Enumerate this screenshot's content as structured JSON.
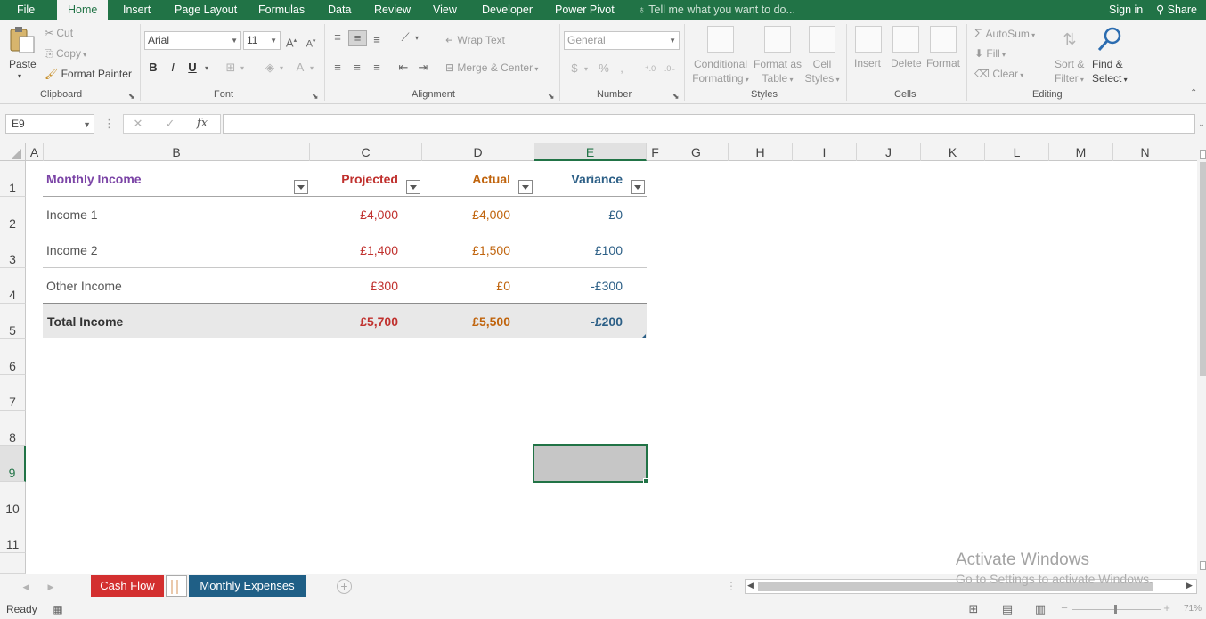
{
  "ribbon_tabs": {
    "file": "File",
    "home": "Home",
    "insert": "Insert",
    "page_layout": "Page Layout",
    "formulas": "Formulas",
    "data": "Data",
    "review": "Review",
    "view": "View",
    "developer": "Developer",
    "power_pivot": "Power Pivot",
    "tell_me": "Tell me what you want to do...",
    "sign_in": "Sign in",
    "share": "Share"
  },
  "clipboard": {
    "paste": "Paste",
    "cut": "Cut",
    "copy": "Copy",
    "format_painter": "Format Painter",
    "label": "Clipboard"
  },
  "font": {
    "name": "Arial",
    "size": "11",
    "bold": "B",
    "italic": "I",
    "underline": "U",
    "label": "Font"
  },
  "alignment": {
    "wrap_text": "Wrap Text",
    "merge_center": "Merge & Center",
    "label": "Alignment"
  },
  "number": {
    "format": "General",
    "currency": "$",
    "percent": "%",
    "comma": ",",
    "label": "Number"
  },
  "styles": {
    "conditional_formatting": [
      "Conditional",
      "Formatting"
    ],
    "format_as_table": [
      "Format as",
      "Table"
    ],
    "cell_styles": [
      "Cell",
      "Styles"
    ],
    "label": "Styles"
  },
  "cells": {
    "insert": "Insert",
    "delete": "Delete",
    "format": "Format",
    "label": "Cells"
  },
  "editing": {
    "autosum": "AutoSum",
    "fill": "Fill",
    "clear": "Clear",
    "sort_filter": [
      "Sort &",
      "Filter"
    ],
    "find_select": [
      "Find &",
      "Select"
    ],
    "label": "Editing"
  },
  "formula_bar": {
    "name_box": "E9",
    "cancel": "✕",
    "enter": "✓",
    "fx": "fx",
    "formula": ""
  },
  "columns": [
    "A",
    "B",
    "C",
    "D",
    "E",
    "F",
    "G",
    "H",
    "I",
    "J",
    "K",
    "L",
    "M",
    "N"
  ],
  "rows": [
    "1",
    "2",
    "3",
    "4",
    "5",
    "6",
    "7",
    "8",
    "9",
    "10",
    "11"
  ],
  "table": {
    "headers": [
      "Monthly Income",
      "Projected",
      "Actual",
      "Variance"
    ],
    "rows": [
      [
        "Income 1",
        "£4,000",
        "£4,000",
        "£0"
      ],
      [
        "Income 2",
        "£1,400",
        "£1,500",
        "£100"
      ],
      [
        "Other Income",
        "£300",
        "£0",
        "-£300"
      ]
    ],
    "total": [
      "Total Income",
      "£5,700",
      "£5,500",
      "-£200"
    ]
  },
  "sheet_tabs": [
    "Cash Flow",
    "Monthly Expenses"
  ],
  "watermark": {
    "title": "Activate Windows",
    "subtitle": "Go to Settings to activate Windows."
  },
  "status": {
    "ready": "Ready",
    "zoom": "71%"
  },
  "colors": {
    "excel_green": "#217346",
    "cash_flow_tab": "#d32f2f",
    "monthly_expenses_tab": "#1f5f86",
    "header_purple": "#7b44a6",
    "projected_red": "#c0312e",
    "actual_orange": "#c0640d",
    "variance_blue": "#2c5f86"
  }
}
